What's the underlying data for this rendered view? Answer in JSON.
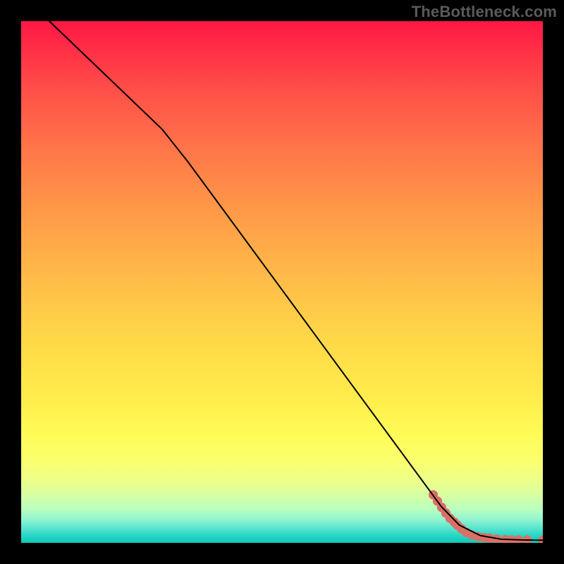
{
  "watermark": "TheBottleneck.com",
  "chart_data": {
    "type": "line",
    "title": "",
    "xlabel": "",
    "ylabel": "",
    "xlim": [
      0,
      100
    ],
    "ylim": [
      0,
      100
    ],
    "grid": false,
    "legend": false,
    "series": [
      {
        "name": "curve",
        "color": "#000000",
        "points": [
          {
            "x": 5.4,
            "y": 100.0
          },
          {
            "x": 27.0,
            "y": 79.3
          },
          {
            "x": 32.0,
            "y": 73.0
          },
          {
            "x": 80.5,
            "y": 7.0
          },
          {
            "x": 84.0,
            "y": 3.4
          },
          {
            "x": 88.0,
            "y": 1.4
          },
          {
            "x": 92.0,
            "y": 0.7
          },
          {
            "x": 96.0,
            "y": 0.55
          },
          {
            "x": 100.0,
            "y": 0.5
          }
        ]
      }
    ],
    "scatter": {
      "name": "data-points",
      "color": "#d97066",
      "radius_norm": 0.009,
      "points": [
        {
          "x": 79.0,
          "y": 9.2
        },
        {
          "x": 79.8,
          "y": 8.0
        },
        {
          "x": 80.6,
          "y": 6.8
        },
        {
          "x": 81.4,
          "y": 5.7
        },
        {
          "x": 82.2,
          "y": 4.7
        },
        {
          "x": 83.0,
          "y": 4.0
        },
        {
          "x": 83.6,
          "y": 3.4
        },
        {
          "x": 84.4,
          "y": 2.7
        },
        {
          "x": 85.3,
          "y": 2.0
        },
        {
          "x": 86.4,
          "y": 1.5
        },
        {
          "x": 87.6,
          "y": 1.2
        },
        {
          "x": 88.7,
          "y": 1.0
        },
        {
          "x": 89.8,
          "y": 0.9
        },
        {
          "x": 91.2,
          "y": 0.7
        },
        {
          "x": 92.8,
          "y": 0.6
        },
        {
          "x": 94.0,
          "y": 0.55
        },
        {
          "x": 95.3,
          "y": 0.55
        },
        {
          "x": 97.0,
          "y": 0.55
        },
        {
          "x": 100.0,
          "y": 0.5
        }
      ]
    },
    "background": {
      "type": "vertical-gradient",
      "stops": [
        {
          "pos": 0.0,
          "color": "#ff1744"
        },
        {
          "pos": 0.5,
          "color": "#ffd148"
        },
        {
          "pos": 0.8,
          "color": "#fffb56"
        },
        {
          "pos": 0.92,
          "color": "#d0ffb0"
        },
        {
          "pos": 1.0,
          "color": "#0ecab9"
        }
      ]
    }
  }
}
